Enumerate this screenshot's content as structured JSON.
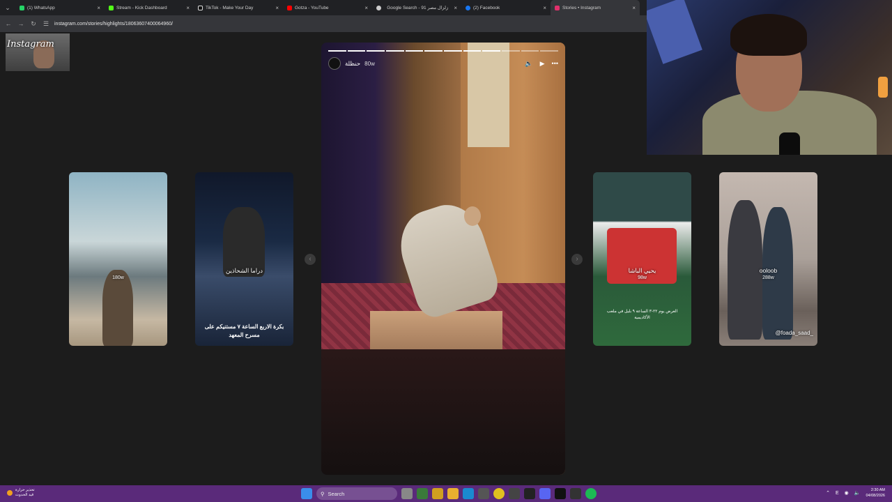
{
  "browser": {
    "tabs": [
      {
        "label": "(1) WhatsApp",
        "color": "#25d366",
        "active": false
      },
      {
        "label": "Stream - Kick Dashboard",
        "color": "#53fc18",
        "active": false
      },
      {
        "label": "TikTok - Make Your Day",
        "color": "#111111",
        "active": false
      },
      {
        "label": "Gotza - YouTube",
        "color": "#ff0000",
        "active": false
      },
      {
        "label": "Google Search - زلزال مصر 91",
        "color": "#cccccc",
        "active": false
      },
      {
        "label": "(2) Facebook",
        "color": "#1877f2",
        "active": false
      },
      {
        "label": "Stories • Instagram",
        "color": "#e1306c",
        "active": true
      }
    ],
    "url": "instagram.com/stories/highlights/18063607400064960/"
  },
  "overlay": {
    "logo_text": "Instagram"
  },
  "story": {
    "username": "حنظلة",
    "time": "80w",
    "segments_total": 12,
    "segments_done": 9
  },
  "side_cards": [
    {
      "name": "",
      "age": "180w",
      "caption": "",
      "handle": ""
    },
    {
      "name": "دراما الشحاذين",
      "age": "",
      "caption": "بكرة الاربع الساعة ٧ مستنيكم على مسرح المعهد",
      "handle": ""
    },
    {
      "name": "يحيي الباشا",
      "age": "98w",
      "caption": "العرض يوم ٢٢-٣ الساعة ٩ بليل في ملعب الأكاديمية",
      "handle": ""
    },
    {
      "name": "ooloob",
      "age": "288w",
      "caption": "",
      "handle": "@foada_saad_"
    }
  ],
  "taskbar": {
    "weather_line1": "تحذير حرارة",
    "weather_line2": "قيد الحدوث",
    "search_label": "Search",
    "time": "2:30 AM",
    "date": "04/08/2026",
    "lang": "E"
  }
}
